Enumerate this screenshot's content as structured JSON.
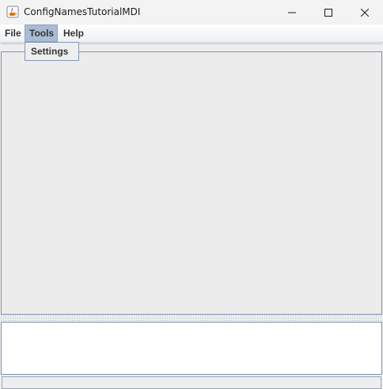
{
  "window": {
    "title": "ConfigNamesTutorialMDI"
  },
  "menubar": {
    "file": "File",
    "tools": "Tools",
    "help": "Help"
  },
  "tools_menu": {
    "items": [
      "Settings"
    ]
  },
  "icons": {
    "app": "java-cup-icon",
    "minimize": "minimize-icon",
    "maximize": "maximize-icon",
    "close": "close-icon",
    "split_up": "arrow-up-icon",
    "split_down": "arrow-down-icon"
  },
  "colors": {
    "menu_highlight": "#a9bcd3",
    "border_accent": "#7a93b4",
    "desktop_bg": "#ececec"
  }
}
